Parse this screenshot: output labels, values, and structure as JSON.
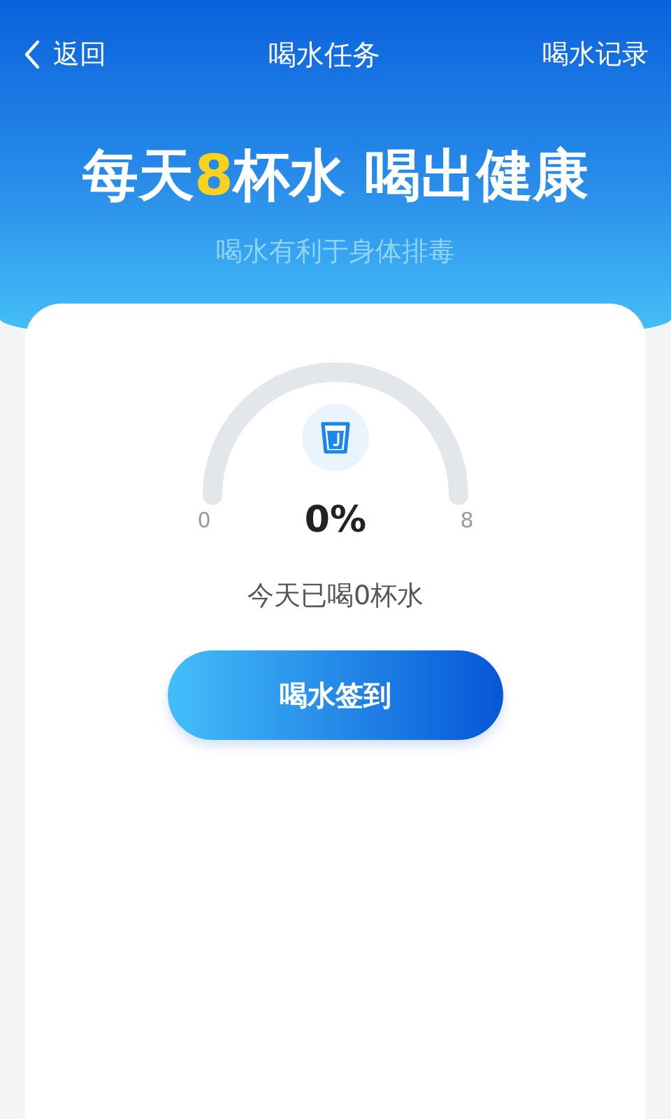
{
  "nav": {
    "back": "返回",
    "title": "喝水任务",
    "action": "喝水记录"
  },
  "banner": {
    "headline": "每天**8**杯水 喝出健康",
    "subtitle": "喝水有利于身体排毒"
  },
  "gauge": {
    "min_label": "0",
    "max_label": "8",
    "percent": "0%"
  },
  "summary": "今天已喝0杯水",
  "checkin_button": "喝水签到"
}
